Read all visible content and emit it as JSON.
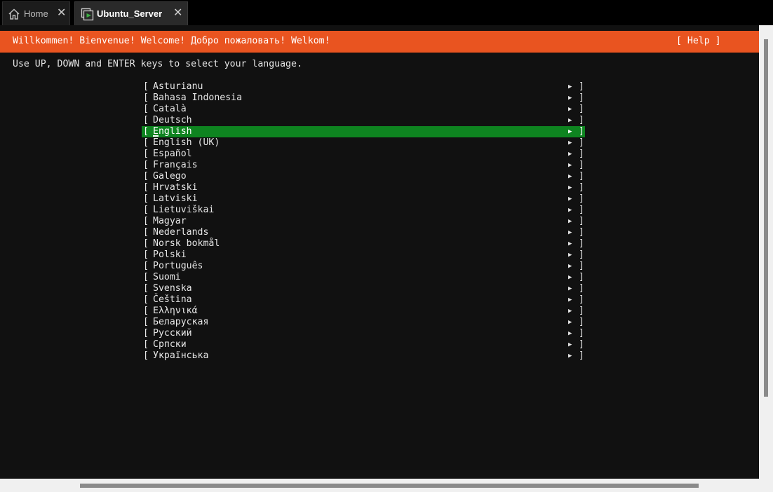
{
  "tabs": [
    {
      "label": "Home",
      "icon": "home-icon",
      "active": false
    },
    {
      "label": "Ubuntu_Server",
      "icon": "vm-console-icon",
      "active": true
    }
  ],
  "banner": {
    "title": "Willkommen! Bienvenue! Welcome! Добро пожаловать! Welkom!",
    "help": "[ Help ]",
    "color": "#e95420"
  },
  "instructions": "Use UP, DOWN and ENTER keys to select your language.",
  "languages": [
    "Asturianu",
    "Bahasa Indonesia",
    "Català",
    "Deutsch",
    "English",
    "English (UK)",
    "Español",
    "Français",
    "Galego",
    "Hrvatski",
    "Latviski",
    "Lietuviškai",
    "Magyar",
    "Nederlands",
    "Norsk bokmål",
    "Polski",
    "Português",
    "Suomi",
    "Svenska",
    "Čeština",
    "Ελληνικά",
    "Беларуская",
    "Русский",
    "Српски",
    "Українська"
  ],
  "selected_index": 4,
  "selection_color": "#0e8420",
  "bracket_open": "[",
  "bracket_close": "]",
  "arrow": "▶"
}
